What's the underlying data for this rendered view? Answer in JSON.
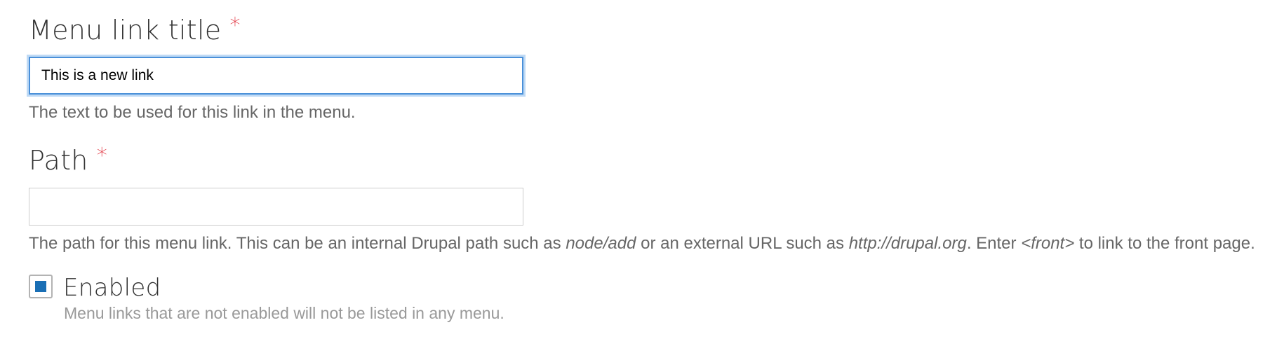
{
  "menu_link_title": {
    "label": "Menu link title",
    "required_marker": "*",
    "value": "This is a new link",
    "description": "The text to be used for this link in the menu."
  },
  "path": {
    "label": "Path",
    "required_marker": "*",
    "value": "",
    "description": {
      "part1": "The path for this menu link. This can be an internal Drupal path such as ",
      "example_internal": "node/add",
      "part2": " or an external URL such as ",
      "example_external": "http://drupal.org",
      "part3": ". Enter ",
      "example_front": "<front>",
      "part4": " to link to the front page."
    }
  },
  "enabled": {
    "label": "Enabled",
    "checked": true,
    "description": "Menu links that are not enabled will not be listed in any menu."
  },
  "colors": {
    "required": "#e1333f",
    "focus_border": "#4a90d9",
    "checkbox_fill": "#1a6fb5"
  }
}
